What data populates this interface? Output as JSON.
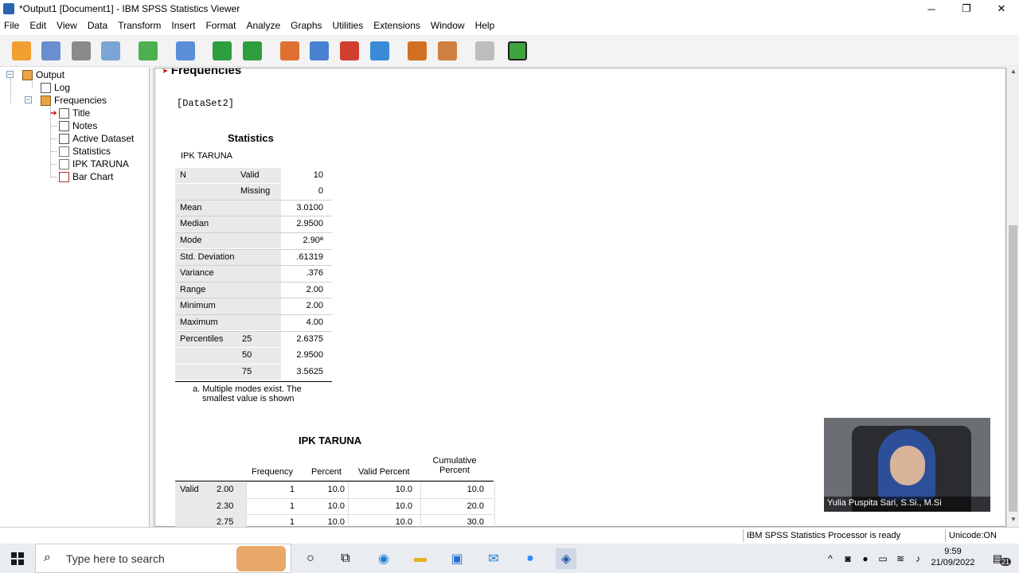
{
  "window": {
    "title": "*Output1 [Document1] - IBM SPSS Statistics Viewer",
    "controls": {
      "minimize": "─",
      "restore": "❐",
      "close": "✕"
    }
  },
  "menu": [
    "File",
    "Edit",
    "View",
    "Data",
    "Transform",
    "Insert",
    "Format",
    "Analyze",
    "Graphs",
    "Utilities",
    "Extensions",
    "Window",
    "Help"
  ],
  "toolbar_icons": [
    "open-icon",
    "save-icon",
    "print-icon",
    "print-preview-icon",
    "export-icon",
    "recall-dialog-icon",
    "undo-icon",
    "redo-icon",
    "goto-data-icon",
    "goto-case-icon",
    "goto-variable-icon",
    "variables-icon",
    "insert-output-icon",
    "designate-window-icon",
    "disabled-icon",
    "add-icon"
  ],
  "toolbar_colors": [
    "#f0a030",
    "#6a8fd0",
    "#8a8a8a",
    "#7aa6d6",
    "#4caf50",
    "#5a8fd8",
    "#2e9f3e",
    "#2e9f3e",
    "#e07030",
    "#4a80d0",
    "#d04030",
    "#3a8ad8",
    "#d07020",
    "#d08040",
    "#bdbdbd",
    "#3fa33f"
  ],
  "nav_tree": {
    "items": [
      {
        "label": "Output",
        "icon": "output-book-icon"
      },
      {
        "label": "Log",
        "icon": "log-icon"
      },
      {
        "label": "Frequencies",
        "icon": "frequencies-book-icon"
      },
      {
        "label": "Title",
        "icon": "title-icon"
      },
      {
        "label": "Notes",
        "icon": "notes-icon"
      },
      {
        "label": "Active Dataset",
        "icon": "active-dataset-icon"
      },
      {
        "label": "Statistics",
        "icon": "statistics-table-icon"
      },
      {
        "label": "IPK TARUNA",
        "icon": "frequency-table-icon"
      },
      {
        "label": "Bar Chart",
        "icon": "bar-chart-icon"
      }
    ],
    "expand_minus": "−"
  },
  "output": {
    "heading": "Frequencies",
    "dataset": "[DataSet2]",
    "statistics": {
      "title": "Statistics",
      "variable": "IPK TARUNA",
      "rows": [
        {
          "label": "N",
          "sub": "Valid",
          "value": "10"
        },
        {
          "label": "",
          "sub": "Missing",
          "value": "0"
        },
        {
          "label": "Mean",
          "sub": "",
          "value": "3.0100"
        },
        {
          "label": "Median",
          "sub": "",
          "value": "2.9500"
        },
        {
          "label": "Mode",
          "sub": "",
          "value": "2.90ª"
        },
        {
          "label": "Std. Deviation",
          "sub": "",
          "value": ".61319"
        },
        {
          "label": "Variance",
          "sub": "",
          "value": ".376"
        },
        {
          "label": "Range",
          "sub": "",
          "value": "2.00"
        },
        {
          "label": "Minimum",
          "sub": "",
          "value": "2.00"
        },
        {
          "label": "Maximum",
          "sub": "",
          "value": "4.00"
        },
        {
          "label": "Percentiles",
          "sub": "25",
          "value": "2.6375"
        },
        {
          "label": "",
          "sub": "50",
          "value": "2.9500"
        },
        {
          "label": "",
          "sub": "75",
          "value": "3.5625"
        }
      ],
      "footnote_line1": "a. Multiple modes exist. The",
      "footnote_line2": "smallest value is shown"
    },
    "frequency": {
      "title": "IPK TARUNA",
      "headers": [
        "Frequency",
        "Percent",
        "Valid Percent",
        "Cumulative"
      ],
      "header_cum_line2": "Percent",
      "rows": [
        {
          "group": "Valid",
          "value": "2.00",
          "freq": "1",
          "pct": "10.0",
          "valid": "10.0",
          "cum": "10.0"
        },
        {
          "group": "",
          "value": "2.30",
          "freq": "1",
          "pct": "10.0",
          "valid": "10.0",
          "cum": "20.0"
        },
        {
          "group": "",
          "value": "2.75",
          "freq": "1",
          "pct": "10.0",
          "valid": "10.0",
          "cum": "30.0"
        }
      ]
    }
  },
  "webcam": {
    "name": "Yulia Puspita Sari, S.Si., M.Si"
  },
  "status": {
    "processor": "IBM SPSS Statistics Processor is ready",
    "unicode": "Unicode:ON"
  },
  "taskbar": {
    "search_placeholder": "Type here to search",
    "time": "9:59",
    "date": "21/09/2022",
    "notifications": "21"
  }
}
